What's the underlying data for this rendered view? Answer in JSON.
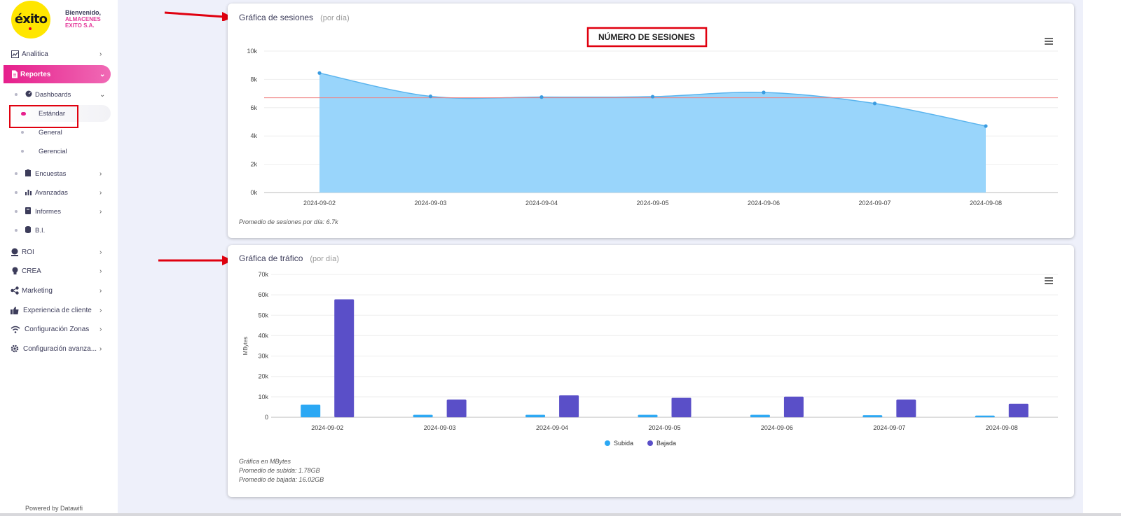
{
  "sidebar": {
    "logo_text": "éxito",
    "welcome_line1": "Bienvenido,",
    "welcome_line2": "ALMACENES",
    "welcome_line3": "EXITO S.A.",
    "items": [
      {
        "label": "Analitica",
        "icon": "chart-icon"
      },
      {
        "label": "Reportes",
        "icon": "document-icon"
      },
      {
        "label": "Dashboards",
        "icon": "gauge-icon"
      },
      {
        "label": "Estándar"
      },
      {
        "label": "General"
      },
      {
        "label": "Gerencial"
      },
      {
        "label": "Encuestas",
        "icon": "clipboard-icon"
      },
      {
        "label": "Avanzadas",
        "icon": "bar-chart-icon"
      },
      {
        "label": "Informes",
        "icon": "book-icon"
      },
      {
        "label": "B.I.",
        "icon": "database-icon"
      },
      {
        "label": "ROI",
        "icon": "money-icon"
      },
      {
        "label": "CREA",
        "icon": "lightbulb-icon"
      },
      {
        "label": "Marketing",
        "icon": "share-icon"
      },
      {
        "label": "Experiencia de cliente",
        "icon": "thumbs-up-icon"
      },
      {
        "label": "Configuración Zonas",
        "icon": "wifi-icon"
      },
      {
        "label": "Configuración avanza...",
        "icon": "gear-icon"
      }
    ],
    "powered_by": "Powered by Datawifi"
  },
  "sessions_card": {
    "title": "Gráfica de sesiones",
    "subtitle": "(por día)",
    "footer": "Promedio de sesiones por día: 6.7k"
  },
  "traffic_card": {
    "title": "Gráfica de tráfico",
    "subtitle": "(por día)",
    "footer1": "Gráfica en MBytes",
    "footer2": "Promedio de subida: 1.78GB",
    "footer3": "Promedio de bajada: 16.02GB"
  },
  "colors": {
    "accent": "#e61f8c",
    "area_fill": "#99d5fb",
    "area_line": "#5ab4ee",
    "avg_line": "#f08080",
    "subida": "#2ba8f4",
    "bajada": "#5a4fc8"
  },
  "chart_data": [
    {
      "type": "area",
      "title": "NÚMERO DE SESIONES",
      "x": [
        "2024-09-02",
        "2024-09-03",
        "2024-09-04",
        "2024-09-05",
        "2024-09-06",
        "2024-09-07",
        "2024-09-08"
      ],
      "values": [
        8450,
        6800,
        6750,
        6780,
        7080,
        6300,
        4700
      ],
      "ylim": [
        0,
        10000
      ],
      "yticks": [
        "0k",
        "2k",
        "4k",
        "6k",
        "8k",
        "10k"
      ],
      "average_line": 6700,
      "grid": true
    },
    {
      "type": "bar",
      "title": "",
      "ylabel": "MBytes",
      "categories": [
        "2024-09-02",
        "2024-09-03",
        "2024-09-04",
        "2024-09-05",
        "2024-09-06",
        "2024-09-07",
        "2024-09-08"
      ],
      "series": [
        {
          "name": "Subida",
          "values": [
            6200,
            1200,
            1200,
            1200,
            1200,
            1000,
            800
          ]
        },
        {
          "name": "Bajada",
          "values": [
            57800,
            8700,
            10800,
            9600,
            10100,
            8700,
            6600
          ]
        }
      ],
      "ylim": [
        0,
        70000
      ],
      "yticks": [
        "0",
        "10k",
        "20k",
        "30k",
        "40k",
        "50k",
        "60k",
        "70k"
      ],
      "legend": "bottom",
      "grid": true
    }
  ]
}
